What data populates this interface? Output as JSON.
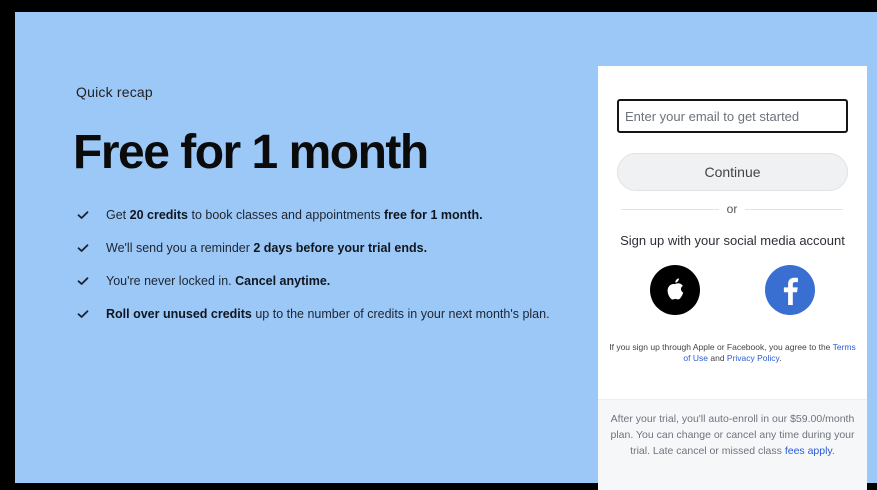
{
  "recap_label": "Quick recap",
  "headline": "Free for 1 month",
  "benefits": [
    {
      "parts": [
        {
          "text": "Get ",
          "bold": false
        },
        {
          "text": "20 credits",
          "bold": true
        },
        {
          "text": " to book classes and appointments ",
          "bold": false
        },
        {
          "text": "free for 1 month.",
          "bold": true
        }
      ]
    },
    {
      "parts": [
        {
          "text": "We'll send you a reminder ",
          "bold": false
        },
        {
          "text": "2 days before your trial ends.",
          "bold": true
        }
      ]
    },
    {
      "parts": [
        {
          "text": "You're never locked in. ",
          "bold": false
        },
        {
          "text": "Cancel anytime.",
          "bold": true
        }
      ]
    },
    {
      "parts": [
        {
          "text": "Roll over unused credits",
          "bold": true
        },
        {
          "text": " up to the number of credits in your next month's plan.",
          "bold": false
        }
      ]
    }
  ],
  "signup": {
    "email_placeholder": "Enter your email to get started",
    "email_value": "",
    "continue_label": "Continue",
    "or_label": "or",
    "social_title": "Sign up with your social media account",
    "social_buttons": [
      "apple-icon",
      "facebook-icon"
    ],
    "legal_prefix": "If you sign up through Apple or Facebook, you agree to the ",
    "terms_link": "Terms of Use",
    "legal_and": " and ",
    "privacy_link": "Privacy Policy",
    "legal_suffix": "."
  },
  "trial_note": {
    "text": "After your trial, you'll auto-enroll in our $59.00/month plan. You can change or cancel any time during your trial. Late cancel or missed class ",
    "link": "fees apply",
    "suffix": "."
  },
  "colors": {
    "background": "#9cc8f8",
    "card": "#ffffff",
    "link": "#2a5bd7",
    "facebook": "#3a6fd2",
    "apple": "#000000"
  }
}
